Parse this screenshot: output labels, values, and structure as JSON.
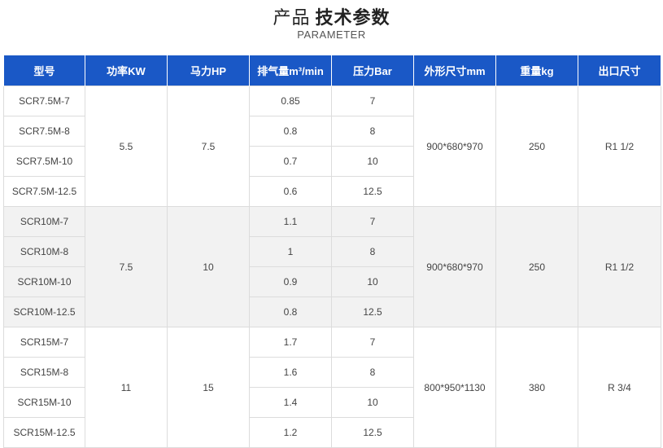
{
  "header": {
    "title_prefix": "产品",
    "title_main": "技术参数",
    "subtitle": "PARAMETER"
  },
  "table": {
    "columns": [
      "型号",
      "功率KW",
      "马力HP",
      "排气量m³/min",
      "压力Bar",
      "外形尺寸mm",
      "重量kg",
      "出口尺寸"
    ],
    "groups": [
      {
        "power_kw": "5.5",
        "hp": "7.5",
        "dimensions": "900*680*970",
        "weight": "250",
        "outlet": "R1 1/2",
        "rows": [
          {
            "model": "SCR7.5M-7",
            "displacement": "0.85",
            "pressure": "7"
          },
          {
            "model": "SCR7.5M-8",
            "displacement": "0.8",
            "pressure": "8"
          },
          {
            "model": "SCR7.5M-10",
            "displacement": "0.7",
            "pressure": "10"
          },
          {
            "model": "SCR7.5M-12.5",
            "displacement": "0.6",
            "pressure": "12.5"
          }
        ]
      },
      {
        "power_kw": "7.5",
        "hp": "10",
        "dimensions": "900*680*970",
        "weight": "250",
        "outlet": "R1 1/2",
        "rows": [
          {
            "model": "SCR10M-7",
            "displacement": "1.1",
            "pressure": "7"
          },
          {
            "model": "SCR10M-8",
            "displacement": "1",
            "pressure": "8"
          },
          {
            "model": "SCR10M-10",
            "displacement": "0.9",
            "pressure": "10"
          },
          {
            "model": "SCR10M-12.5",
            "displacement": "0.8",
            "pressure": "12.5"
          }
        ]
      },
      {
        "power_kw": "11",
        "hp": "15",
        "dimensions": "800*950*1130",
        "weight": "380",
        "outlet": "R 3/4",
        "rows": [
          {
            "model": "SCR15M-7",
            "displacement": "1.7",
            "pressure": "7"
          },
          {
            "model": "SCR15M-8",
            "displacement": "1.6",
            "pressure": "8"
          },
          {
            "model": "SCR15M-10",
            "displacement": "1.4",
            "pressure": "10"
          },
          {
            "model": "SCR15M-12.5",
            "displacement": "1.2",
            "pressure": "12.5"
          }
        ]
      }
    ]
  },
  "colors": {
    "header_bg": "#1a58c6",
    "alt_group_bg": "#f2f2f2"
  }
}
